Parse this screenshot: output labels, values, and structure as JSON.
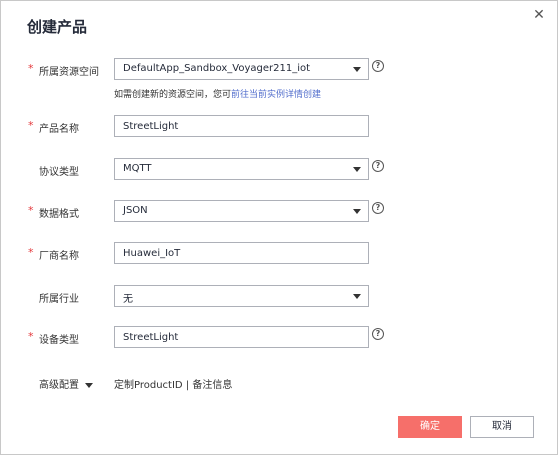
{
  "dialog": {
    "title": "创建产品",
    "close_glyph": "✕"
  },
  "fields": {
    "resource_space": {
      "label": "所属资源空间",
      "required": true,
      "value": "DefaultApp_Sandbox_Voyager211_iot",
      "help": "?"
    },
    "resource_hint": {
      "text": "如需创建新的资源空间，您可",
      "link": "前往当前实例详情创建"
    },
    "product_name": {
      "label": "产品名称",
      "required": true,
      "value": "StreetLight"
    },
    "protocol": {
      "label": "协议类型",
      "required": false,
      "value": "MQTT",
      "help": "?"
    },
    "data_format": {
      "label": "数据格式",
      "required": true,
      "value": "JSON",
      "help": "?"
    },
    "vendor": {
      "label": "厂商名称",
      "required": true,
      "value": "Huawei_IoT"
    },
    "industry": {
      "label": "所属行业",
      "required": false,
      "value": "无"
    },
    "device_type": {
      "label": "设备类型",
      "required": true,
      "value": "StreetLight",
      "help": "?"
    }
  },
  "advanced": {
    "label": "高级配置",
    "links": "定制ProductID | 备注信息"
  },
  "buttons": {
    "ok": "确定",
    "cancel": "取消"
  },
  "colors": {
    "required_star": "#e4393c",
    "link": "#526ecc",
    "primary_button": "#f66f6a"
  },
  "icons": {
    "help": "question-circle-icon",
    "dropdown": "caret-down-icon",
    "close": "close-icon"
  }
}
